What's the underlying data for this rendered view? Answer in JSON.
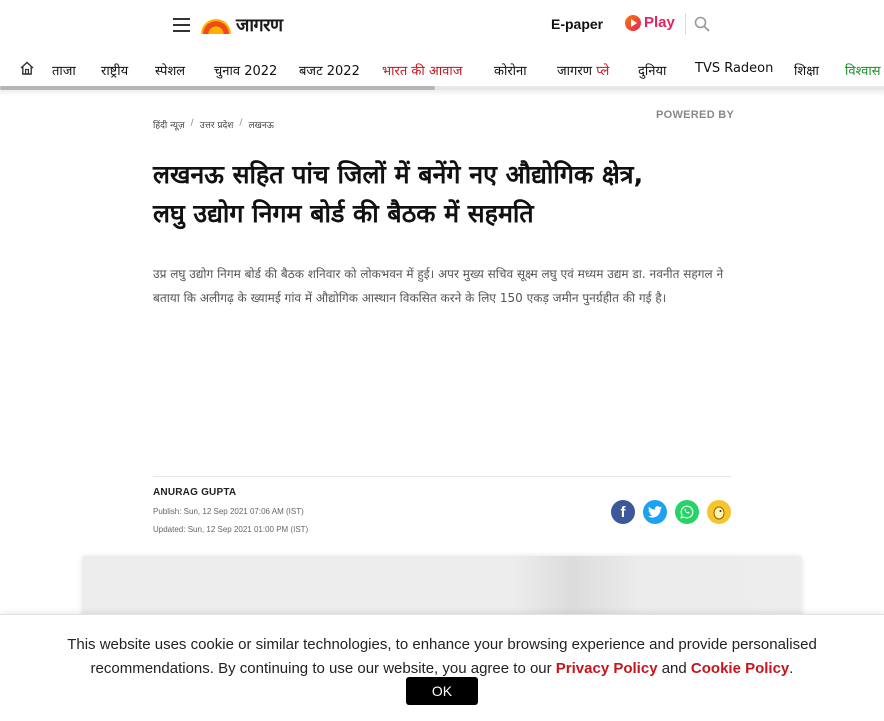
{
  "header": {
    "logo_text": "जागरण",
    "epaper_label": "E-paper",
    "play_label": "Play"
  },
  "nav": {
    "items": [
      {
        "label": "ताजा"
      },
      {
        "label": "राष्ट्रीय"
      },
      {
        "label": "स्पेशल"
      },
      {
        "label": "चुनाव 2022"
      },
      {
        "label": "बजट 2022"
      },
      {
        "label": "भारत की आवाज"
      },
      {
        "label": "कोरोना"
      },
      {
        "label": "जागरण",
        "tag": "प्ले"
      },
      {
        "label": "दुनिया"
      },
      {
        "label": "TVS Radeon"
      },
      {
        "label": "शिक्षा"
      },
      {
        "label": "विश्वास"
      }
    ],
    "colors": {
      "highlight": "#c4161c",
      "green": "#1a8f2a"
    }
  },
  "article": {
    "breadcrumb": [
      "हिंदी न्यूज़",
      "उत्तर प्रदेश",
      "लखनऊ"
    ],
    "powered_by": "POWERED BY",
    "headline_line1": "लखनऊ सहित पांच जिलों में बनेंगे नए औद्योगिक क्षेत्र,",
    "headline_line2": "लघु उद्योग निगम बोर्ड की बैठक में सहमति",
    "summary": "उप्र लघु उद्योग निगम बोर्ड की बैठक शनिवार को लोकभवन में हुई। अपर मुख्य सचिव सूक्ष्म लघु एवं मध्यम उद्यम डा. नवनीत सहगल ने बताया कि अलीगढ़ के ख्यामई गांव में औद्योगिक आस्थान विकसित करने के लिए 150 एकड़ जमीन पुनर्ग्रहीत की गई है।",
    "author": "ANURAG GUPTA",
    "publish": "Publish: Sun, 12 Sep 2021 07:06 AM (IST)",
    "updated": "Updated: Sun, 12 Sep 2021 01:00 PM (IST)"
  },
  "share": {
    "icons": [
      "facebook-icon",
      "twitter-icon",
      "whatsapp-icon",
      "koo-icon"
    ],
    "facebook_glyph": "f"
  },
  "cookie": {
    "text_part1": "This website uses cookie or similar technologies, to enhance your browsing experience and provide personalised recommendations. By continuing to use our website, you agree to our ",
    "privacy_label": "Privacy Policy",
    "and_text": " and ",
    "cookie_label": "Cookie Policy",
    "end_text": ".",
    "ok_label": "OK"
  }
}
